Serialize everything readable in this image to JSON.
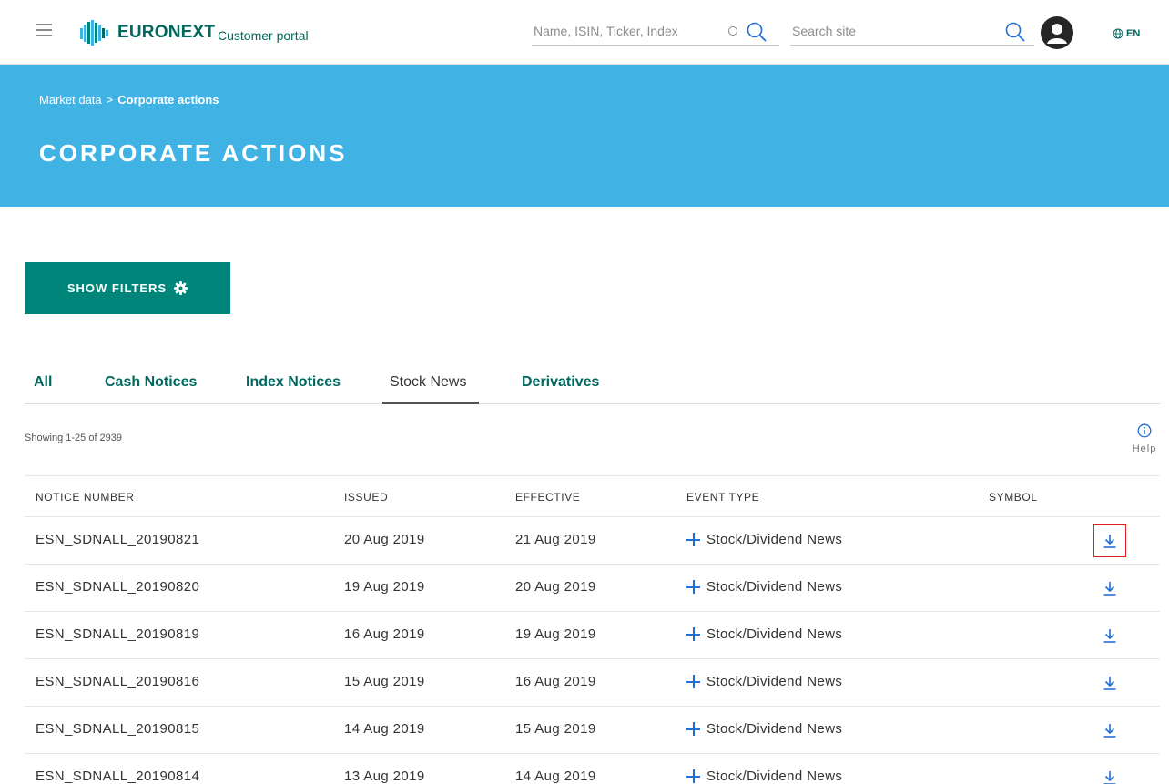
{
  "header": {
    "brand": "EURONEXT",
    "portal_label": "Customer portal",
    "quote_search_placeholder": "Name, ISIN, Ticker, Index",
    "site_search_placeholder": "Search site",
    "lang": "EN"
  },
  "banner": {
    "breadcrumb": [
      "Market data",
      "Corporate actions"
    ],
    "breadcrumb_sep": ">",
    "title": "CORPORATE ACTIONS"
  },
  "filters": {
    "label": "SHOW FILTERS"
  },
  "tabs": [
    {
      "label": "All",
      "active": false
    },
    {
      "label": "Cash Notices",
      "active": false
    },
    {
      "label": "Index Notices",
      "active": false
    },
    {
      "label": "Stock News",
      "active": true
    },
    {
      "label": "Derivatives",
      "active": false
    }
  ],
  "results": {
    "showing": "Showing 1-25 of 2939",
    "help": "Help"
  },
  "table": {
    "columns": [
      "NOTICE NUMBER",
      "ISSUED",
      "EFFECTIVE",
      "EVENT TYPE",
      "SYMBOL"
    ],
    "rows": [
      {
        "notice": "ESN_SDNALL_20190821",
        "issued": "20 Aug 2019",
        "effective": "21 Aug 2019",
        "event": "Stock/Dividend News",
        "symbol": ""
      },
      {
        "notice": "ESN_SDNALL_20190820",
        "issued": "19 Aug 2019",
        "effective": "20 Aug 2019",
        "event": "Stock/Dividend News",
        "symbol": ""
      },
      {
        "notice": "ESN_SDNALL_20190819",
        "issued": "16 Aug 2019",
        "effective": "19 Aug 2019",
        "event": "Stock/Dividend News",
        "symbol": ""
      },
      {
        "notice": "ESN_SDNALL_20190816",
        "issued": "15 Aug 2019",
        "effective": "16 Aug 2019",
        "event": "Stock/Dividend News",
        "symbol": ""
      },
      {
        "notice": "ESN_SDNALL_20190815",
        "issued": "14 Aug 2019",
        "effective": "15 Aug 2019",
        "event": "Stock/Dividend News",
        "symbol": ""
      },
      {
        "notice": "ESN_SDNALL_20190814",
        "issued": "13 Aug 2019",
        "effective": "14 Aug 2019",
        "event": "Stock/Dividend News",
        "symbol": ""
      }
    ]
  },
  "colors": {
    "brand": "#00685e",
    "banner": "#41b2e4",
    "button": "#00857a",
    "link_blue": "#1f6fd6",
    "highlight": "#e21b1b"
  },
  "icons": [
    "menu-icon",
    "euronext-logo",
    "spinner-icon",
    "search-icon",
    "user-icon",
    "globe-icon",
    "gear-icon",
    "info-icon",
    "plus-icon",
    "download-icon"
  ]
}
